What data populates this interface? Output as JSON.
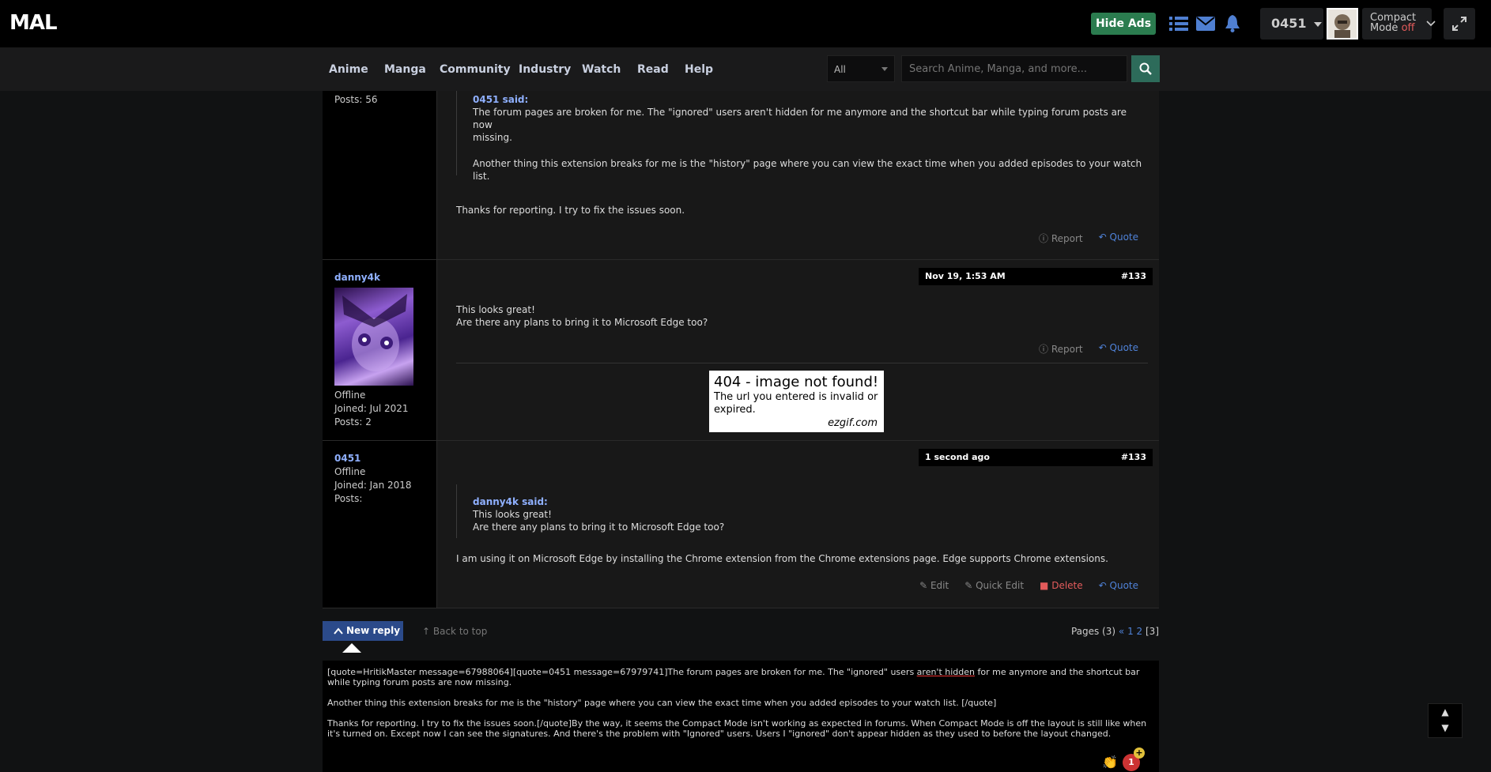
{
  "topbar": {
    "logo": "MAL",
    "hide_ads": "Hide Ads",
    "username": "0451",
    "compact_label_1": "Compact",
    "compact_label_2": "Mode",
    "compact_state": "off"
  },
  "nav": {
    "items": [
      "Anime",
      "Manga",
      "Community",
      "Industry",
      "Watch",
      "Read",
      "Help"
    ],
    "filter": "All",
    "search_placeholder": "Search Anime, Manga, and more..."
  },
  "posts": [
    {
      "side_posts": "Posts: 56",
      "quote_header": "0451 said:",
      "quote_lines": [
        "The forum pages are broken for me. The \"ignored\" users aren't hidden for me anymore and the shortcut bar while typing forum posts are now",
        "missing.",
        "Another thing this extension breaks for me is the \"history\" page where you can view the exact time when you added episodes to your watch list."
      ],
      "body": "Thanks for reporting. I try to fix the issues soon.",
      "actions": [
        "Report",
        "Quote"
      ]
    },
    {
      "username": "danny4k",
      "status": "Offline",
      "joined": "Joined: Jul 2021",
      "posts": "Posts: 2",
      "date": "Nov 19, 1:53 AM",
      "number": "#133",
      "body_lines": [
        "This looks great!",
        "Are there any plans to bring it to Microsoft Edge too?"
      ],
      "actions": [
        "Report",
        "Quote"
      ],
      "signature_image": {
        "title": "404 - image not found!",
        "text": "The url you entered is invalid or expired.",
        "brand": "ezgif.com"
      }
    },
    {
      "username": "0451",
      "status": "Offline",
      "joined": "Joined: Jan 2018",
      "posts": "Posts:",
      "date": "1 second ago",
      "number": "#133",
      "quote_header": "danny4k said:",
      "quote_lines": [
        "This looks great!",
        "Are there any plans to bring it to Microsoft Edge too?"
      ],
      "body": "I am using it on Microsoft Edge by installing the Chrome extension from the Chrome extensions page. Edge supports Chrome extensions.",
      "actions": [
        "Edit",
        "Quick Edit",
        "Delete",
        "Quote"
      ]
    }
  ],
  "footer": {
    "new_reply": "New reply",
    "back_to_top": "Back to top",
    "pages_label": "Pages (3)",
    "pages_prev": "«",
    "page_1": "1",
    "page_2": "2",
    "page_current": "[3]"
  },
  "reply": {
    "line1_a": "[quote=HritikMaster message=67988064][quote=0451 message=67979741]The forum pages are broken for me. The \"ignored\" users ",
    "line1_spell": "aren't hidden",
    "line1_b": " for me anymore and the shortcut bar while typing forum posts are now missing.",
    "line2": "Another thing this extension breaks for me is the \"history\" page where you can view the exact time when you added episodes to your watch list. [/quote]",
    "line3": "Thanks for reporting. I try to fix the issues soon.[/quote]By the way, it seems the Compact Mode isn't working as expected in forums. When Compact Mode is off the layout is still like when it's turned on. Except now I can see the signatures. And there's the problem with \"Ignored\" users. Users I \"ignored\" don't appear hidden as they used to before the layout changed.",
    "notification_count": "1"
  },
  "scroll": {
    "up": "▲",
    "down": "▼"
  }
}
